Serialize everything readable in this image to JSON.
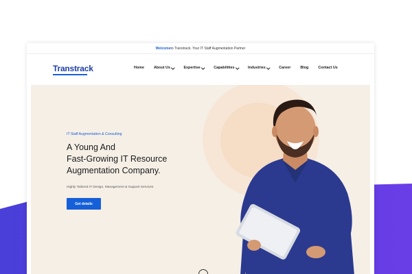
{
  "topbar": {
    "highlight": "Welcome",
    "text": " to Transtrack. Your IT Staff Augmentation Partner"
  },
  "brand": {
    "logo_text": "Transtrack",
    "accent": "#1560d9"
  },
  "nav": {
    "items": [
      {
        "label": "Home",
        "dropdown": false
      },
      {
        "label": "About Us",
        "dropdown": true
      },
      {
        "label": "Expertise",
        "dropdown": true
      },
      {
        "label": "Capabilities",
        "dropdown": true
      },
      {
        "label": "Industries",
        "dropdown": true
      },
      {
        "label": "Career",
        "dropdown": false
      },
      {
        "label": "Blog",
        "dropdown": false
      },
      {
        "label": "Contact Us",
        "dropdown": false
      }
    ]
  },
  "hero": {
    "eyebrow": "IT Staff Augmentation & Consulting",
    "headline_lines": [
      "A Young And",
      "Fast-Growing IT Resource",
      "Augmentation Company."
    ],
    "subtitle": "Highly Tailored IT Design, Management & Support Services.",
    "cta_label": "Get details",
    "bg_color": "#f5efe6"
  },
  "backdrop_color": "#4f3ddc"
}
